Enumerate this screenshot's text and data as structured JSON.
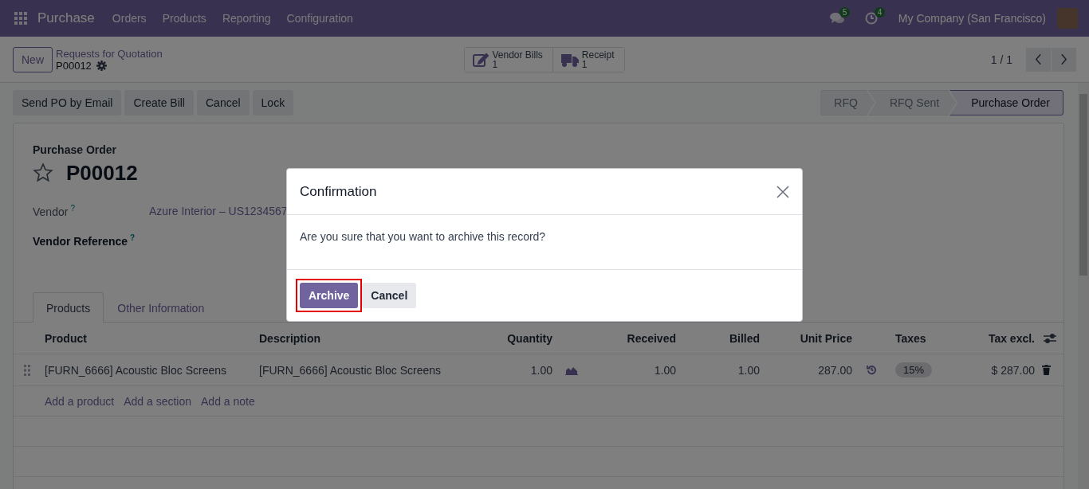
{
  "navbar": {
    "app_name": "Purchase",
    "menu": [
      "Orders",
      "Products",
      "Reporting",
      "Configuration"
    ],
    "messages_count": "5",
    "activities_count": "4",
    "company": "My Company (San Francisco)"
  },
  "control_panel": {
    "new_button": "New",
    "breadcrumb_parent": "Requests for Quotation",
    "breadcrumb_current": "P00012",
    "smart_buttons": [
      {
        "label": "Vendor Bills",
        "count": "1",
        "kind": "bill"
      },
      {
        "label": "Receipt",
        "count": "1",
        "kind": "receipt"
      }
    ],
    "pager": "1 / 1"
  },
  "action_buttons": [
    "Send PO by Email",
    "Create Bill",
    "Cancel",
    "Lock"
  ],
  "statusbar": [
    {
      "label": "RFQ",
      "selected": false
    },
    {
      "label": "RFQ Sent",
      "selected": false
    },
    {
      "label": "Purchase Order",
      "selected": true
    }
  ],
  "form": {
    "record_type": "Purchase Order",
    "name": "P00012",
    "starred": false,
    "fields": [
      {
        "label": "Vendor",
        "help": "?",
        "value": "Azure Interior – US1234567",
        "bold": false
      },
      {
        "label": "Vendor Reference",
        "help": "?",
        "bold": true
      }
    ],
    "tabs": [
      {
        "label": "Products",
        "selected": true
      },
      {
        "label": "Other Information",
        "selected": false
      }
    ],
    "table": {
      "columns": [
        "Product",
        "Description",
        "Quantity",
        "Received",
        "Billed",
        "Unit Price",
        "Taxes",
        "Tax excl."
      ],
      "rows": [
        {
          "cells": [
            "[FURN_6666] Acoustic Bloc Screens",
            "[FURN_6666] Acoustic Bloc Screens",
            "1.00",
            "1.00",
            "1.00",
            "287.00",
            "15%",
            "$ 287.00"
          ]
        }
      ],
      "add_links": [
        "Add a product",
        "Add a section",
        "Add a note"
      ]
    }
  },
  "dialog": {
    "title": "Confirmation",
    "message": "Are you sure that you want to archive this record?",
    "buttons": [
      {
        "label": "Archive",
        "kind": "primary",
        "highlighted": true
      },
      {
        "label": "Cancel",
        "kind": "secondary",
        "highlighted": false
      }
    ]
  }
}
